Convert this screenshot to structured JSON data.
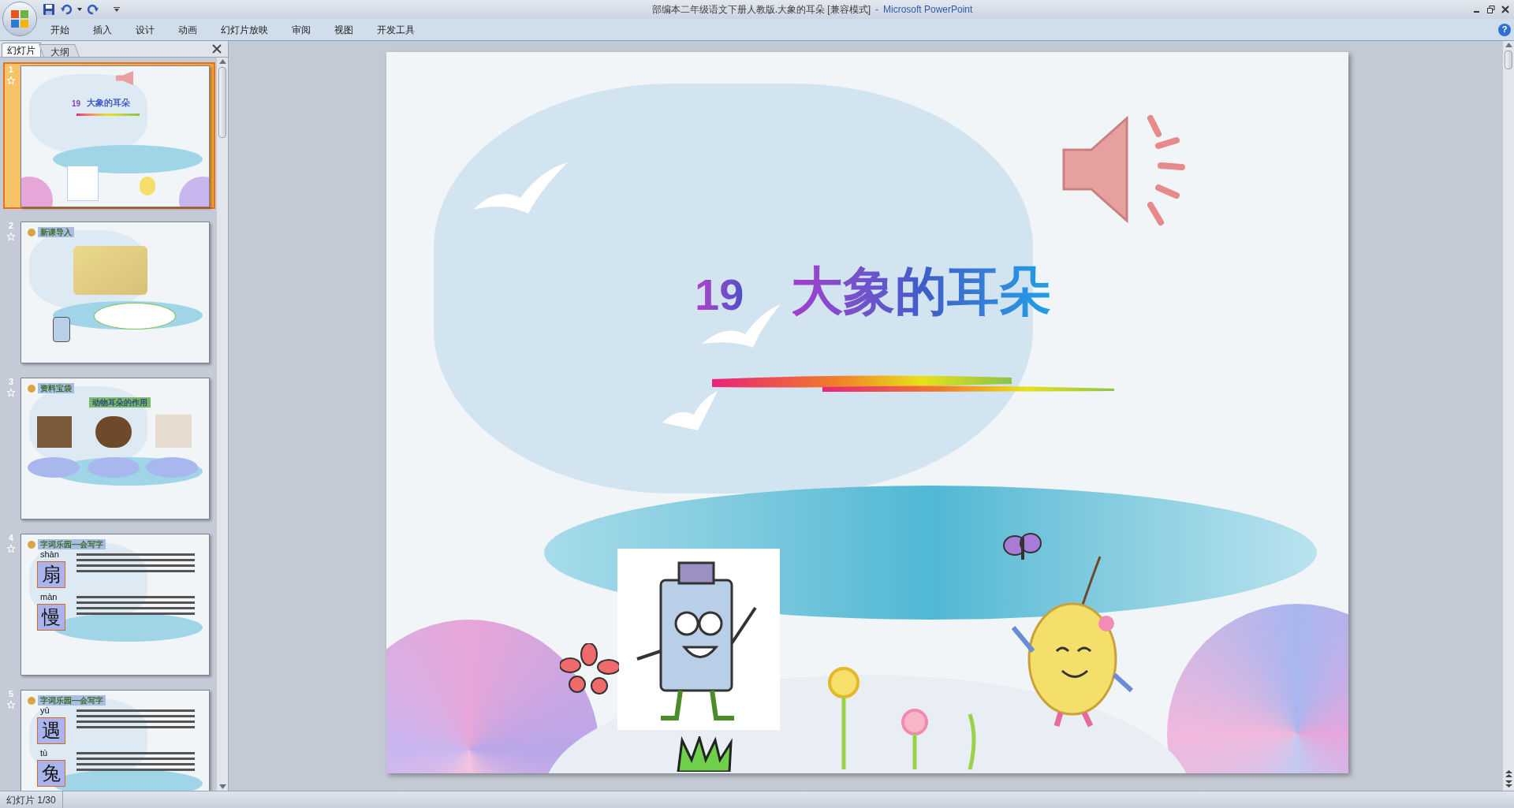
{
  "window": {
    "title": "部编本二年级语文下册人教版.大象的耳朵 [兼容模式]",
    "separator": "-",
    "app_name": "Microsoft PowerPoint"
  },
  "ribbon_tabs": [
    {
      "label": "开始",
      "selected": false
    },
    {
      "label": "插入",
      "selected": false
    },
    {
      "label": "设计",
      "selected": false
    },
    {
      "label": "动画",
      "selected": false
    },
    {
      "label": "幻灯片放映",
      "selected": false
    },
    {
      "label": "审阅",
      "selected": false
    },
    {
      "label": "视图",
      "selected": false
    },
    {
      "label": "开发工具",
      "selected": false
    }
  ],
  "pane_tabs": [
    {
      "label": "幻灯片",
      "selected": true
    },
    {
      "label": "大纲",
      "selected": false
    }
  ],
  "slides": [
    {
      "number": "1",
      "selected": true,
      "kind": "title",
      "lesson_number": "19",
      "title": "大象的耳朵"
    },
    {
      "number": "2",
      "selected": false,
      "kind": "intro",
      "heading": "新课导入"
    },
    {
      "number": "3",
      "selected": false,
      "kind": "info",
      "heading": "资料宝袋",
      "subheading": "动物耳朵的作用"
    },
    {
      "number": "4",
      "selected": false,
      "kind": "characters",
      "heading": "字词乐园—会写字",
      "characters": [
        {
          "pinyin": "shàn",
          "char": "扇"
        },
        {
          "pinyin": "màn",
          "char": "慢"
        }
      ]
    },
    {
      "number": "5",
      "selected": false,
      "kind": "characters",
      "heading": "字词乐园—会写字",
      "characters": [
        {
          "pinyin": "yù",
          "char": "遇"
        },
        {
          "pinyin": "tù",
          "char": "兔"
        }
      ]
    }
  ],
  "current_slide": {
    "lesson_number": "19",
    "title": "大象的耳朵"
  },
  "status_bar": {
    "slide_indicator": "幻灯片 1/30"
  },
  "help_button": {
    "glyph": "?"
  }
}
